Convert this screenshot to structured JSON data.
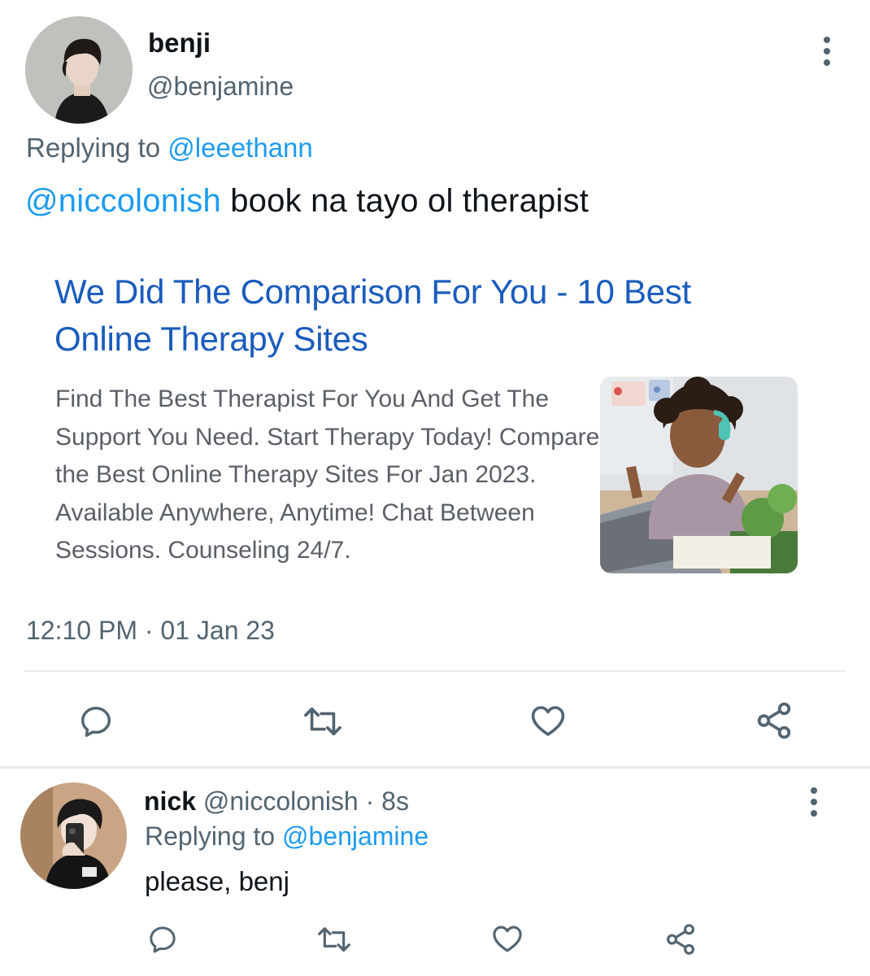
{
  "main_tweet": {
    "display_name": "benji",
    "handle": "@benjamine",
    "replying_prefix": "Replying to",
    "replying_to": "@leeethann",
    "mention": "@niccolonish",
    "text": "book na tayo ol therapist",
    "timestamp": "12:10 PM · 01 Jan 23",
    "avatar_icon": "avatar-photo"
  },
  "ad_card": {
    "title": "We Did The Comparison For You - 10 Best Online Therapy Sites",
    "description": "Find The Best Therapist For You And Get The Support You Need. Start Therapy Today! Compare the Best Online Therapy Sites For Jan 2023. Available Anywhere, Anytime! Chat Between Sessions. Counseling 24/7.",
    "image_icon": "girl-with-headphones-photo",
    "title_color": "#1a5bbd"
  },
  "actions": {
    "icons": [
      "reply-icon",
      "retweet-icon",
      "like-icon",
      "share-icon"
    ]
  },
  "reply_tweet": {
    "display_name": "nick",
    "handle": "@niccolonish",
    "time_sep": "·",
    "time": "8s",
    "replying_prefix": "Replying to",
    "replying_to": "@benjamine",
    "text": "please, benj"
  },
  "colors": {
    "link": "#1d9bf0",
    "secondary_text": "#536471",
    "divider": "#e6ecf0"
  }
}
